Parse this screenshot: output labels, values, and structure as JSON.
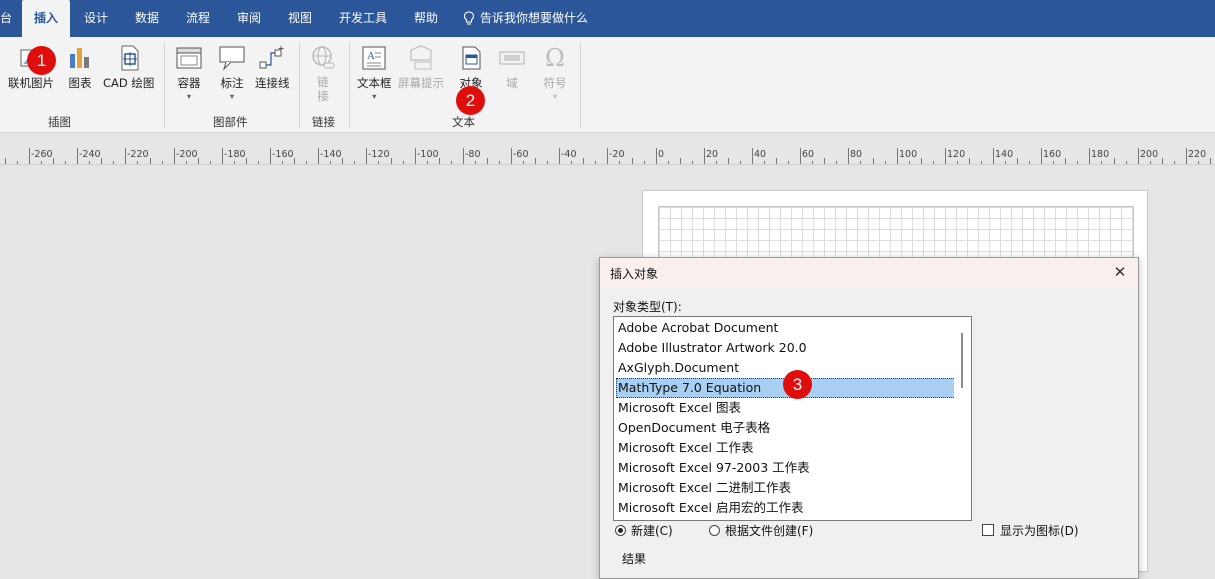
{
  "tabs": [
    "台",
    "插入",
    "设计",
    "数据",
    "流程",
    "审阅",
    "视图",
    "开发工具",
    "帮助"
  ],
  "active_tab": "插入",
  "tell_me": "告诉我你想要做什么",
  "ribbon": {
    "illustrations": {
      "online_pictures": "联机图片",
      "chart": "图表",
      "cad_drawing": "CAD 绘图",
      "group": "插图"
    },
    "diagram_parts": {
      "container": "容器",
      "callout": "标注",
      "connector": "连接线",
      "group": "图部件"
    },
    "links": {
      "link": "链\n接",
      "group": "链接"
    },
    "text": {
      "textbox": "文本框",
      "screentip": "屏幕提示",
      "object": "对象",
      "field": "域",
      "symbol": "符号",
      "group": "文本"
    }
  },
  "ruler_labels": [
    "-260",
    "-240",
    "-220",
    "-200",
    "-180",
    "-160",
    "-140",
    "-120",
    "-100",
    "-80",
    "-60",
    "-40",
    "-20",
    "0",
    "20",
    "40",
    "60",
    "80",
    "100",
    "120",
    "140",
    "160",
    "180",
    "200",
    "220"
  ],
  "dialog": {
    "title": "插入对象",
    "close": "✕",
    "object_type_label": "对象类型(T):",
    "items": [
      "Adobe Acrobat Document",
      "Adobe Illustrator Artwork 20.0",
      "AxGlyph.Document",
      "MathType 7.0 Equation",
      "Microsoft Excel 图表",
      "OpenDocument 电子表格",
      "Microsoft Excel 工作表",
      "Microsoft Excel 97-2003 工作表",
      "Microsoft Excel 二进制工作表",
      "Microsoft Excel 启用宏的工作表"
    ],
    "selected_item": "MathType 7.0 Equation",
    "radio_new": "新建(C)",
    "radio_from_file": "根据文件创建(F)",
    "show_as_icon": "显示为图标(D)",
    "result_label": "结果"
  },
  "markers": [
    "1",
    "2",
    "3"
  ],
  "colors": {
    "ribbon_blue": "#2b579a",
    "marker_red": "#e00d0d",
    "selection": "#a9d0f2"
  }
}
